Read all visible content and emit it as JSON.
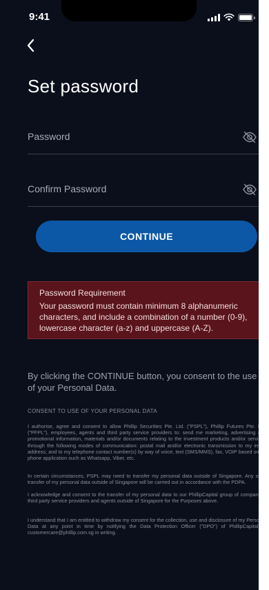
{
  "status_bar": {
    "time": "9:41"
  },
  "header": {
    "title": "Set password"
  },
  "form": {
    "password_placeholder": "Password",
    "confirm_placeholder": "Confirm Password",
    "continue_label": "CONTINUE"
  },
  "requirement": {
    "title": "Password Requirement",
    "text": "Your password must contain minimum 8 alphanumeric characters, and include a combination of a number (0-9), lowercase character (a-z) and uppercase (A-Z)."
  },
  "consent": {
    "intro": "By clicking the CONTINUE button, you consent to the use of your Personal Data.",
    "heading": "CONSENT TO USE OF YOUR PERSONAL DATA",
    "para1": "I authorise, agree and consent to allow Phillip Securities Pte. Ltd. (\"PSPL\"), Phillip Futures Pte. Ltd. (\"PFPL\"), employees, agents and third party service providers to: send me marketing, advertising and promotional information, materials and/or documents relating to the investment products and/or services through the following modes of communication: postal mail and/or electronic transmission to my email address; and to my telephone contact number(s) by way of voice, text (SMS/MMS), fax, VOIP based smart phone application such as Whatsapp, Viber, etc.",
    "para2": "In certain circumstances, PSPL may need to transfer my personal data outside of Singapore. Any such transfer of my personal data outside of Singapore will be carried out in accordance with the PDPA.",
    "para3": "I acknowledge and consent to the transfer of my personal data to our PhillipCapital group of companies, third party service providers and agents outside of Singapore for the Purposes above.",
    "para4": "I understand that I am entitled to withdraw my consent for the collection, use and disclosure of my Personal Data at any point in time by notifying the Data Protection Officer (\"DPO\") of PhillipCapital at customercare@phillip.com.sg in writing."
  },
  "colors": {
    "background": "#0b0f1b",
    "accent": "#0c58a6",
    "requirement_bg": "#5a141c"
  },
  "icons": [
    "back-chevron-icon",
    "eye-off-icon",
    "signal-icon",
    "wifi-icon",
    "battery-icon"
  ]
}
